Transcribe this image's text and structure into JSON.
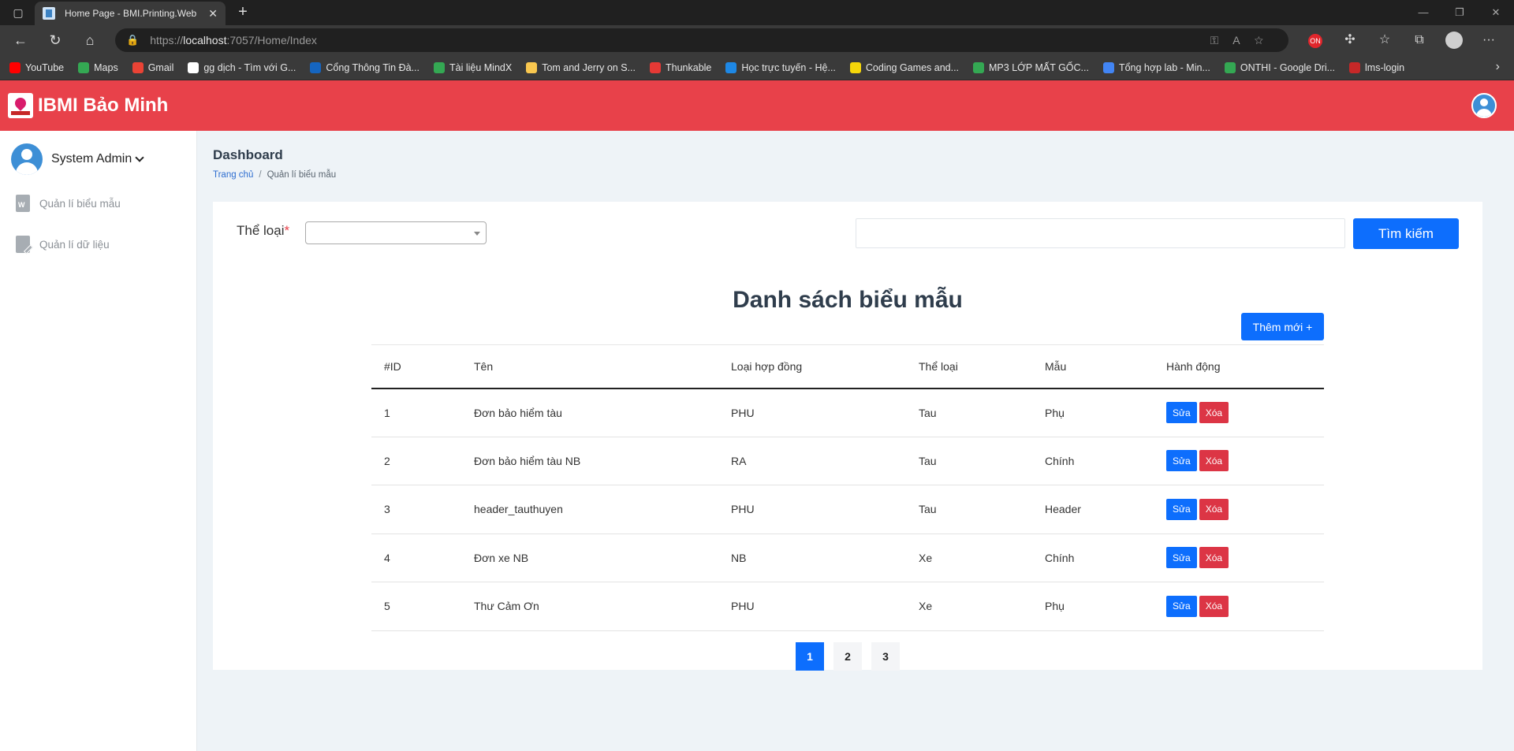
{
  "browser": {
    "tab_title": "Home Page - BMI.Printing.Web",
    "url_scheme": "https://",
    "url_host": "localhost",
    "url_rest": ":7057/Home/Index",
    "bookmarks": [
      {
        "label": "YouTube",
        "color": "#ff0000"
      },
      {
        "label": "Maps",
        "color": "#34a853"
      },
      {
        "label": "Gmail",
        "color": "#ea4335"
      },
      {
        "label": "gg dịch - Tìm với G...",
        "color": "#ffffff"
      },
      {
        "label": "Cổng Thông Tin Đà...",
        "color": "#1565c0"
      },
      {
        "label": "Tài liệu MindX",
        "color": "#34a853"
      },
      {
        "label": "Tom and Jerry on S...",
        "color": "#f9c74f"
      },
      {
        "label": "Thunkable",
        "color": "#e53935"
      },
      {
        "label": "Học trực tuyến - Hệ...",
        "color": "#1e88e5"
      },
      {
        "label": "Coding Games and...",
        "color": "#f5d60a"
      },
      {
        "label": "MP3 LỚP MẤT GỐC...",
        "color": "#34a853"
      },
      {
        "label": "Tổng hợp lab - Min...",
        "color": "#4285f4"
      },
      {
        "label": "ONTHI - Google Dri...",
        "color": "#34a853"
      },
      {
        "label": "lms-login",
        "color": "#c62828"
      }
    ]
  },
  "header": {
    "brand": "IBMI Bảo Minh"
  },
  "sidebar": {
    "user_name": "System Admin",
    "items": [
      {
        "label": "Quản lí biểu mẫu"
      },
      {
        "label": "Quản lí dữ liệu"
      }
    ]
  },
  "page": {
    "title": "Dashboard",
    "breadcrumb_home": "Trang chủ",
    "breadcrumb_sep": "/",
    "breadcrumb_current": "Quản lí biểu mẫu"
  },
  "filter": {
    "label": "Thể loại",
    "required_mark": "*",
    "selected": "",
    "search_value": "",
    "search_button": "Tìm kiếm"
  },
  "list": {
    "title": "Danh sách biểu mẫu",
    "add_button": "Thêm mới +",
    "columns": [
      "#ID",
      "Tên",
      "Loại hợp đồng",
      "Thể loại",
      "Mẫu",
      "Hành động"
    ],
    "rows": [
      {
        "id": "1",
        "name": "Đơn bảo hiểm tàu",
        "contract": "PHU",
        "category": "Tau",
        "template": "Phụ"
      },
      {
        "id": "2",
        "name": "Đơn bảo hiểm tàu NB",
        "contract": "RA",
        "category": "Tau",
        "template": "Chính"
      },
      {
        "id": "3",
        "name": "header_tauthuyen",
        "contract": "PHU",
        "category": "Tau",
        "template": "Header"
      },
      {
        "id": "4",
        "name": "Đơn xe NB",
        "contract": "NB",
        "category": "Xe",
        "template": "Chính"
      },
      {
        "id": "5",
        "name": "Thư Cảm Ơn",
        "contract": "PHU",
        "category": "Xe",
        "template": "Phụ"
      }
    ],
    "edit_label": "Sửa",
    "delete_label": "Xóa",
    "pages": [
      "1",
      "2",
      "3"
    ],
    "current_page": "1"
  }
}
